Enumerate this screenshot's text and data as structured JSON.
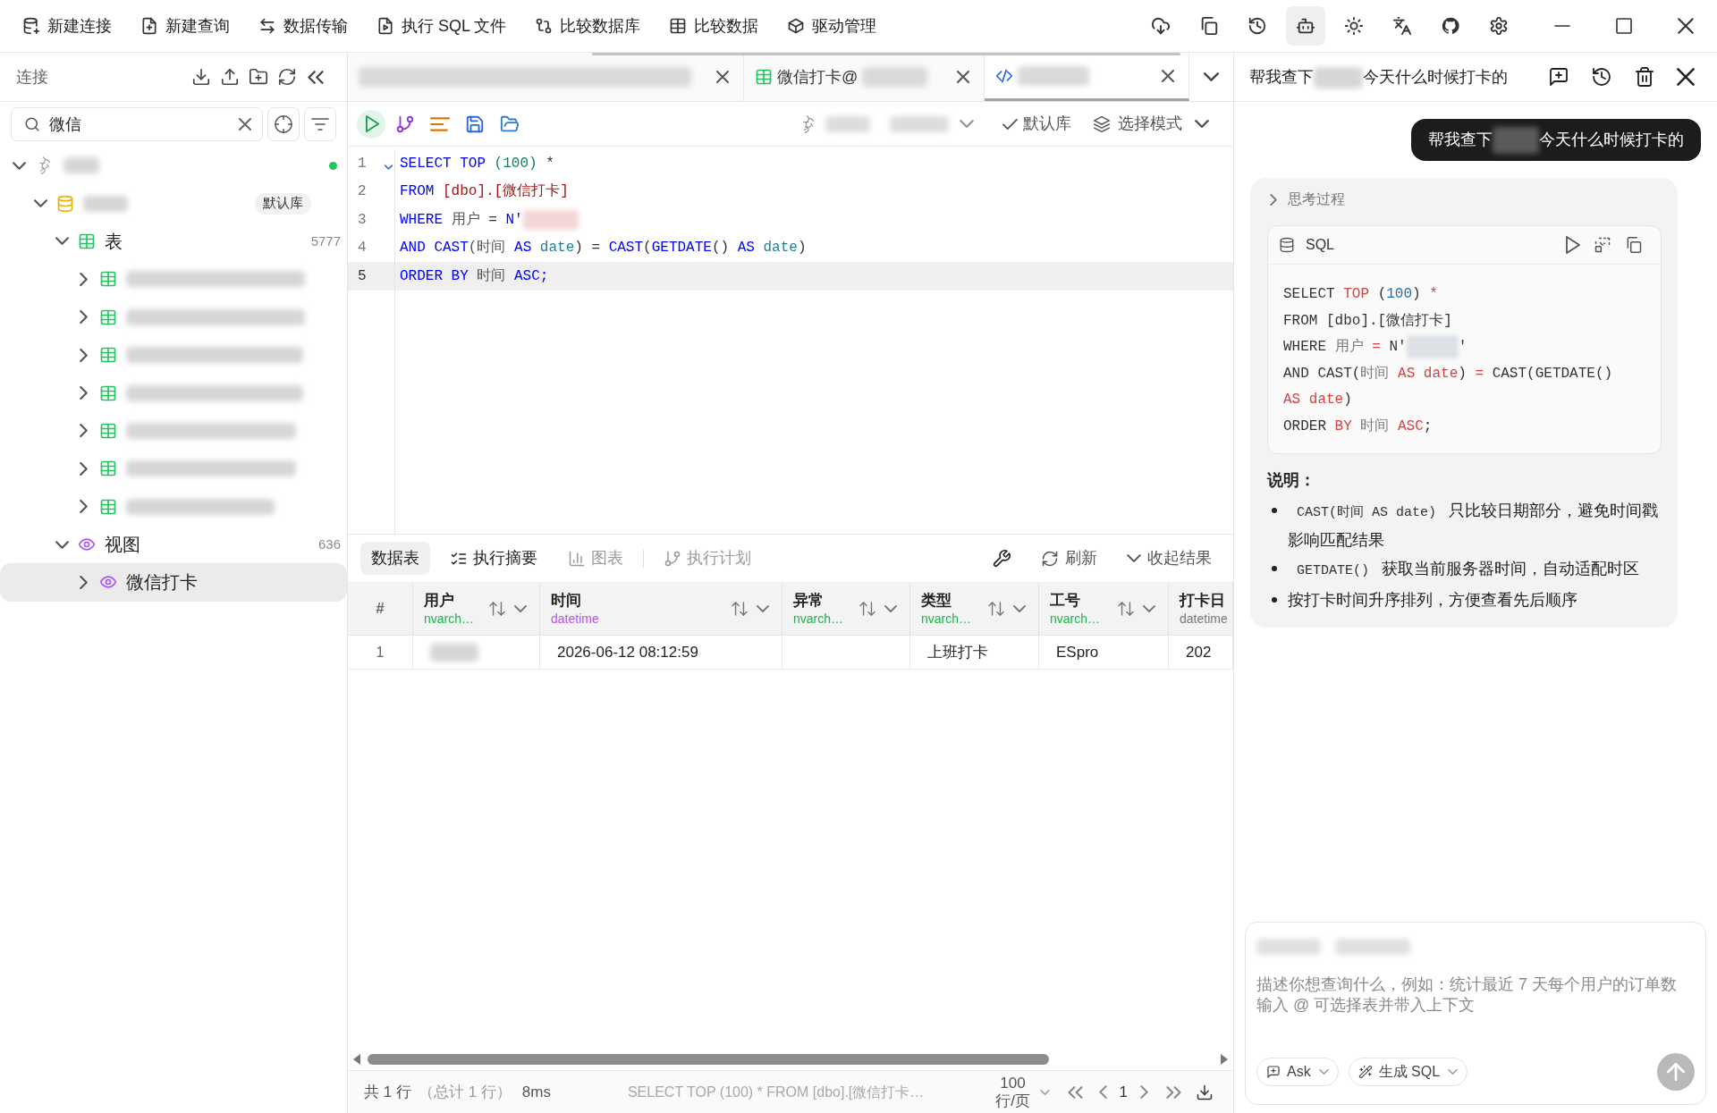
{
  "toolbar": {
    "buttons": [
      "新建连接",
      "新建查询",
      "数据传输",
      "执行 SQL 文件",
      "比较数据库",
      "比较数据",
      "驱动管理"
    ]
  },
  "app_buttons": [
    {
      "active": false
    },
    {
      "active": false
    },
    {
      "active": false
    },
    {
      "active": true
    },
    {
      "active": false
    },
    {
      "active": false
    },
    {
      "active": false
    },
    {
      "active": false
    }
  ],
  "sidebar": {
    "title": "连接",
    "search": {
      "value": "微信"
    },
    "tree": [
      {
        "kind": "connection",
        "expanded": true,
        "connected": true,
        "selected": false,
        "children": [
          {
            "kind": "database",
            "expanded": true,
            "badge": "默认库",
            "selected": false,
            "children": [
              {
                "kind": "table_group",
                "label": "表",
                "count": "5777",
                "expanded": true,
                "selected": false,
                "children": [
                  {
                    "kind": "table",
                    "expanded": false,
                    "selected": false
                  },
                  {
                    "kind": "table",
                    "expanded": false,
                    "selected": false
                  },
                  {
                    "kind": "table",
                    "expanded": false,
                    "selected": false
                  },
                  {
                    "kind": "table",
                    "expanded": false,
                    "selected": false
                  },
                  {
                    "kind": "table",
                    "expanded": false,
                    "selected": false
                  },
                  {
                    "kind": "table",
                    "expanded": false,
                    "selected": false
                  },
                  {
                    "kind": "table",
                    "expanded": false,
                    "selected": false
                  }
                ]
              },
              {
                "kind": "view_group",
                "label": "视图",
                "count": "636",
                "expanded": true,
                "selected": false,
                "children": [
                  {
                    "kind": "view",
                    "label": "微信打卡",
                    "expanded": false,
                    "selected": true
                  }
                ]
              }
            ]
          }
        ]
      }
    ]
  },
  "editor": {
    "tabs": [
      {
        "kind": "query",
        "redacted": true,
        "selected": false
      },
      {
        "kind": "table",
        "label": "微信打卡@",
        "redacted": true,
        "selected": false
      },
      {
        "kind": "sql",
        "redacted": true,
        "selected": true
      }
    ],
    "toolbar": {
      "connection_redacted": true,
      "default_db": {
        "label": "默认库",
        "checked": true
      },
      "mode": {
        "label": "选择模式"
      }
    },
    "lines": [
      {
        "number": "1",
        "current": false,
        "foldable": true,
        "tokens": [
          {
            "text": "SELECT TOP",
            "kind": "keyword"
          },
          {
            "text": " (100)",
            "kind": "number"
          },
          {
            "text": " *",
            "kind": "plain"
          }
        ]
      },
      {
        "number": "2",
        "current": false,
        "foldable": false,
        "tokens": [
          {
            "text": "FROM",
            "kind": "keyword"
          },
          {
            "text": " [dbo].[微信打卡]",
            "kind": "identifier"
          }
        ]
      },
      {
        "number": "3",
        "current": false,
        "foldable": false,
        "tokens": [
          {
            "text": "WHERE",
            "kind": "keyword"
          },
          {
            "text": " 用户",
            "kind": "column"
          },
          {
            "text": " = ",
            "kind": "plain"
          },
          {
            "text": "N'",
            "kind": "keyword"
          },
          {
            "kind": "redacted"
          }
        ]
      },
      {
        "number": "4",
        "current": false,
        "foldable": false,
        "tokens": [
          {
            "text": "AND CAST",
            "kind": "keyword"
          },
          {
            "text": "(时间",
            "kind": "column"
          },
          {
            "text": " AS",
            "kind": "keyword"
          },
          {
            "text": " date",
            "kind": "type"
          },
          {
            "text": ") = ",
            "kind": "plain"
          },
          {
            "text": "CAST",
            "kind": "keyword"
          },
          {
            "text": "(",
            "kind": "plain"
          },
          {
            "text": "GETDATE",
            "kind": "keyword"
          },
          {
            "text": "() ",
            "kind": "plain"
          },
          {
            "text": "AS",
            "kind": "keyword"
          },
          {
            "text": " date",
            "kind": "type"
          },
          {
            "text": ")",
            "kind": "plain"
          }
        ]
      },
      {
        "number": "5",
        "current": true,
        "foldable": false,
        "tokens": [
          {
            "text": "ORDER BY",
            "kind": "keyword"
          },
          {
            "text": " 时间 ",
            "kind": "column"
          },
          {
            "text": "ASC;",
            "kind": "keyword"
          }
        ]
      }
    ]
  },
  "results": {
    "tabs": [
      {
        "label": "数据表",
        "selected": true,
        "disabled": false
      },
      {
        "label": "执行摘要",
        "selected": false,
        "disabled": false
      },
      {
        "label": "图表",
        "selected": false,
        "disabled": true
      },
      {
        "label": "执行计划",
        "selected": false,
        "disabled": true
      }
    ],
    "actions": [
      "刷新",
      "收起结果"
    ],
    "columns": [
      {
        "title": "#",
        "sortable": false
      },
      {
        "title": "用户",
        "type": "nvarch…",
        "color": "#22b14c",
        "sortable": true
      },
      {
        "title": "时间",
        "type": "datetime",
        "color": "#b455e8",
        "sortable": true
      },
      {
        "title": "异常",
        "type": "nvarch…",
        "color": "#22b14c",
        "sortable": true
      },
      {
        "title": "类型",
        "type": "nvarch…",
        "color": "#22b14c",
        "sortable": true
      },
      {
        "title": "工号",
        "type": "nvarch…",
        "color": "#22b14c",
        "sortable": true
      },
      {
        "title": "打卡日",
        "type": "datetime",
        "color": "#777777",
        "sortable": false
      }
    ],
    "rows": [
      {
        "cells": [
          {
            "kind": "text",
            "text": "1"
          },
          {
            "kind": "redacted"
          },
          {
            "kind": "text",
            "text": "2026-06-12 08:12:59"
          },
          {
            "kind": "empty"
          },
          {
            "kind": "text",
            "text": "上班打卡"
          },
          {
            "kind": "text",
            "text": "ESpro"
          },
          {
            "kind": "text",
            "text": "202"
          }
        ]
      }
    ]
  },
  "status_bar": {
    "summary": "共 1 行",
    "total": "（总计 1 行）",
    "elapsed": "8ms",
    "query": "SELECT TOP (100) * FROM [dbo].[微信打卡…",
    "page_size": "100 行/页",
    "page": "1"
  },
  "assistant": {
    "title": [
      "帮我查下",
      "今天什么时候打卡的"
    ],
    "messages": [
      {
        "kind": "user",
        "text": [
          "帮我查下",
          "今天什么时候打卡的"
        ]
      },
      {
        "kind": "assistant",
        "thinking": {
          "label": "思考过程",
          "expanded": false
        },
        "code": {
          "language": "SQL",
          "lines": [
            {
              "tokens": [
                {
                  "text": "SELECT ",
                  "kind": "plain"
                },
                {
                  "text": "TOP",
                  "kind": "keyword"
                },
                {
                  "text": " (",
                  "kind": "plain"
                },
                {
                  "text": "100",
                  "kind": "number"
                },
                {
                  "text": ") ",
                  "kind": "plain"
                },
                {
                  "text": "*",
                  "kind": "operator"
                }
              ]
            },
            {
              "tokens": [
                {
                  "text": "FROM",
                  "kind": "plain"
                },
                {
                  "text": " [dbo].[微信打卡]",
                  "kind": "plain"
                }
              ]
            },
            {
              "tokens": [
                {
                  "text": "WHERE ",
                  "kind": "plain"
                },
                {
                  "text": "用户 ",
                  "kind": "column"
                },
                {
                  "text": "=",
                  "kind": "operator"
                },
                {
                  "text": " N'",
                  "kind": "plain"
                },
                {
                  "kind": "redacted"
                },
                {
                  "text": "'",
                  "kind": "plain"
                }
              ]
            },
            {
              "tokens": [
                {
                  "text": "AND CAST(",
                  "kind": "plain"
                },
                {
                  "text": "时间 ",
                  "kind": "column"
                },
                {
                  "text": "AS date",
                  "kind": "keyword"
                },
                {
                  "text": ") ",
                  "kind": "plain"
                },
                {
                  "text": "=",
                  "kind": "operator"
                },
                {
                  "text": " CAST(GETDATE() ",
                  "kind": "plain"
                },
                {
                  "text": "AS date",
                  "kind": "keyword"
                },
                {
                  "text": ")",
                  "kind": "plain"
                }
              ]
            },
            {
              "tokens": [
                {
                  "text": "ORDER ",
                  "kind": "plain"
                },
                {
                  "text": "BY",
                  "kind": "keyword"
                },
                {
                  "text": " 时间 ",
                  "kind": "column"
                },
                {
                  "text": "ASC",
                  "kind": "keyword"
                },
                {
                  "text": ";",
                  "kind": "plain"
                }
              ]
            }
          ]
        },
        "notes_heading": "说明：",
        "notes": [
          {
            "code": "CAST(时间 AS date)",
            "text": "只比较日期部分，避免时间戳影响匹配结果"
          },
          {
            "code": "GETDATE()",
            "text": "获取当前服务器时间，自动适配时区"
          },
          {
            "text": "按打卡时间升序排列，方便查看先后顺序"
          }
        ]
      }
    ],
    "composer": {
      "context_redacted": true,
      "placeholder": "描述你想查询什么，例如：统计最近 7 天每个用户的订单数输入 @ 可选择表并带入上下文",
      "mode": "Ask",
      "action": "生成 SQL"
    }
  }
}
